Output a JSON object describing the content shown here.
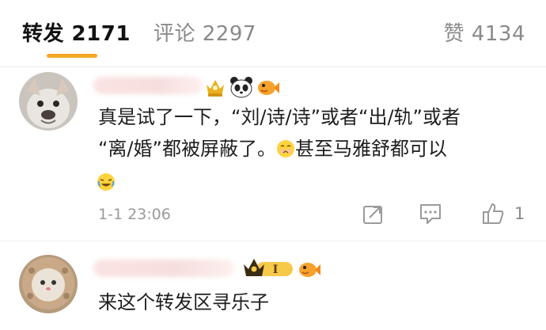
{
  "tabs": {
    "repost_label": "转发 2171",
    "comment_label": "评论 2297",
    "like_label": "赞 4134"
  },
  "comments": [
    {
      "text_line1": "真是试了一下，“刘/诗/诗”或者“出/轨”或者",
      "text_line2a": "“离/婚”都被屏蔽了。",
      "text_line2b": "甚至马雅舒都可以",
      "time": "1-1 23:06",
      "like_count": "1"
    },
    {
      "text_line1": "来这个转发区寻乐子",
      "badge_text": "I"
    }
  ],
  "colors": {
    "accent": "#f5a623",
    "muted": "#8a8a8a"
  },
  "icons": [
    "repost-icon",
    "comment-icon",
    "like-icon",
    "vip-crown-icon",
    "fish-icon",
    "panda-icon"
  ]
}
